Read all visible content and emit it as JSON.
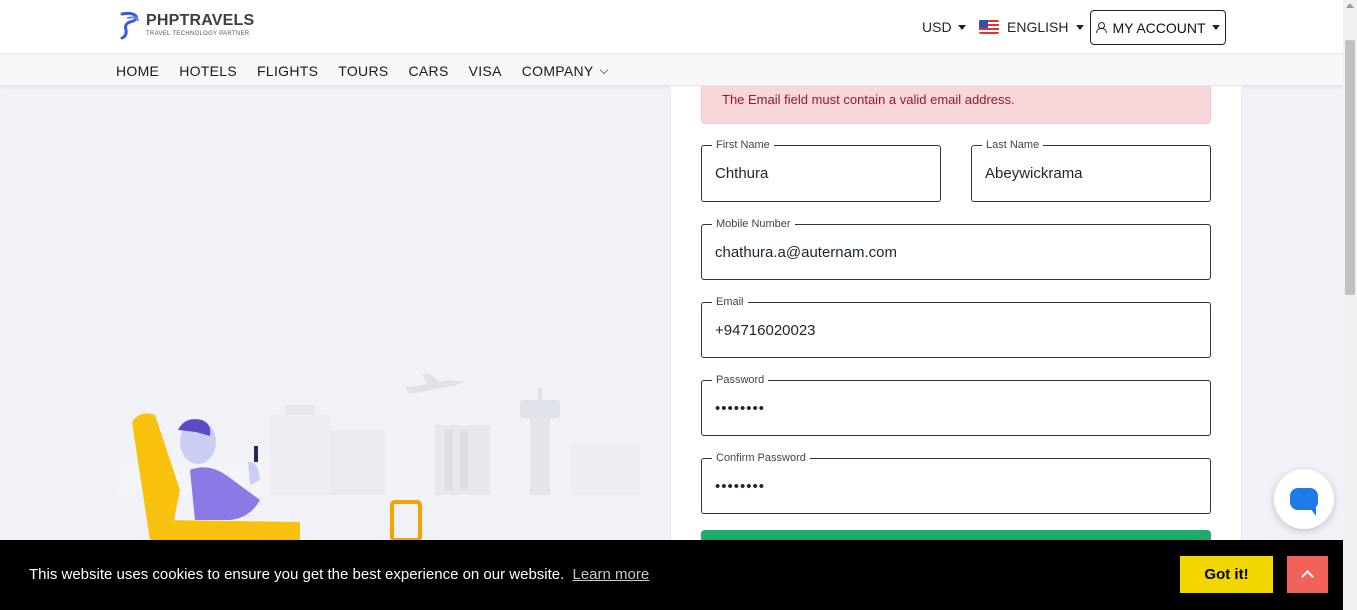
{
  "brand": {
    "name": "PHPTRAVELS",
    "tagline": "TRAVEL TECHNOLOGY PARTNER"
  },
  "header": {
    "currency": "USD",
    "language": "ENGLISH",
    "account_label": "MY ACCOUNT"
  },
  "nav": {
    "items": [
      {
        "label": "HOME"
      },
      {
        "label": "HOTELS"
      },
      {
        "label": "FLIGHTS"
      },
      {
        "label": "TOURS"
      },
      {
        "label": "CARS"
      },
      {
        "label": "VISA"
      },
      {
        "label": "COMPANY"
      }
    ]
  },
  "form": {
    "alert": "The Email field must contain a valid email address.",
    "first_name": {
      "label": "First Name",
      "value": "Chthura"
    },
    "last_name": {
      "label": "Last Name",
      "value": "Abeywickrama"
    },
    "mobile": {
      "label": "Mobile Number",
      "value": "chathura.a@auternam.com"
    },
    "email": {
      "label": "Email",
      "value": "+94716020023"
    },
    "password": {
      "label": "Password",
      "value": "••••••••"
    },
    "confirm_password": {
      "label": "Confirm Password",
      "value": "••••••••"
    }
  },
  "cookie": {
    "message": "This website uses cookies to ensure you get the best experience on our website.",
    "learn_more": "Learn more",
    "accept": "Got it!"
  },
  "colors": {
    "accent_blue": "#1e7be6",
    "alert_bg": "#f8d7da",
    "alert_text": "#8f1c28",
    "submit_green": "#1dab6a",
    "cookie_button": "#f1d600",
    "scroll_top_button": "#f0625a"
  },
  "icons": {
    "user": "user-icon",
    "chat": "chat-icon",
    "flag": "us-flag-icon",
    "scroll_top": "arrow-up-icon"
  }
}
